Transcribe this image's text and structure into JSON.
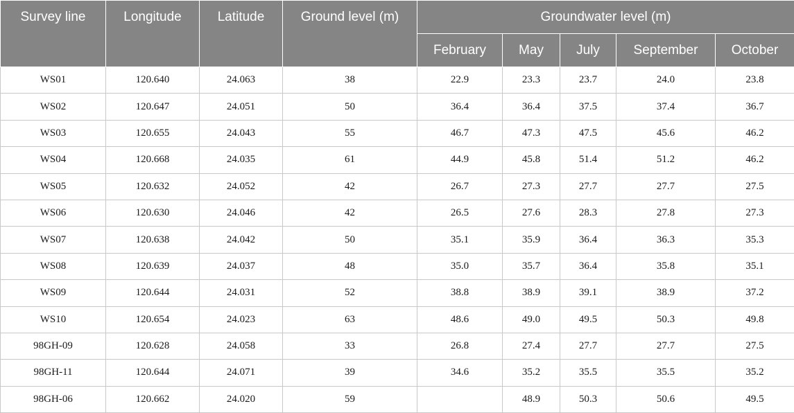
{
  "table": {
    "headers": {
      "survey_line": "Survey line",
      "longitude": "Longitude",
      "latitude": "Latitude",
      "ground_level": "Ground level (m)",
      "groundwater_level": "Groundwater level (m)",
      "months": [
        "February",
        "May",
        "July",
        "September",
        "October"
      ]
    },
    "rows": [
      [
        "WS01",
        "120.640",
        "24.063",
        "38",
        "22.9",
        "23.3",
        "23.7",
        "24.0",
        "23.8"
      ],
      [
        "WS02",
        "120.647",
        "24.051",
        "50",
        "36.4",
        "36.4",
        "37.5",
        "37.4",
        "36.7"
      ],
      [
        "WS03",
        "120.655",
        "24.043",
        "55",
        "46.7",
        "47.3",
        "47.5",
        "45.6",
        "46.2"
      ],
      [
        "WS04",
        "120.668",
        "24.035",
        "61",
        "44.9",
        "45.8",
        "51.4",
        "51.2",
        "46.2"
      ],
      [
        "WS05",
        "120.632",
        "24.052",
        "42",
        "26.7",
        "27.3",
        "27.7",
        "27.7",
        "27.5"
      ],
      [
        "WS06",
        "120.630",
        "24.046",
        "42",
        "26.5",
        "27.6",
        "28.3",
        "27.8",
        "27.3"
      ],
      [
        "WS07",
        "120.638",
        "24.042",
        "50",
        "35.1",
        "35.9",
        "36.4",
        "36.3",
        "35.3"
      ],
      [
        "WS08",
        "120.639",
        "24.037",
        "48",
        "35.0",
        "35.7",
        "36.4",
        "35.8",
        "35.1"
      ],
      [
        "WS09",
        "120.644",
        "24.031",
        "52",
        "38.8",
        "38.9",
        "39.1",
        "38.9",
        "37.2"
      ],
      [
        "WS10",
        "120.654",
        "24.023",
        "63",
        "48.6",
        "49.0",
        "49.5",
        "50.3",
        "49.8"
      ],
      [
        "98GH-09",
        "120.628",
        "24.058",
        "33",
        "26.8",
        "27.4",
        "27.7",
        "27.7",
        "27.5"
      ],
      [
        "98GH-11",
        "120.644",
        "24.071",
        "39",
        "34.6",
        "35.2",
        "35.5",
        "35.5",
        "35.2"
      ],
      [
        "98GH-06",
        "120.662",
        "24.020",
        "59",
        "",
        "48.9",
        "50.3",
        "50.6",
        "49.5"
      ]
    ]
  }
}
